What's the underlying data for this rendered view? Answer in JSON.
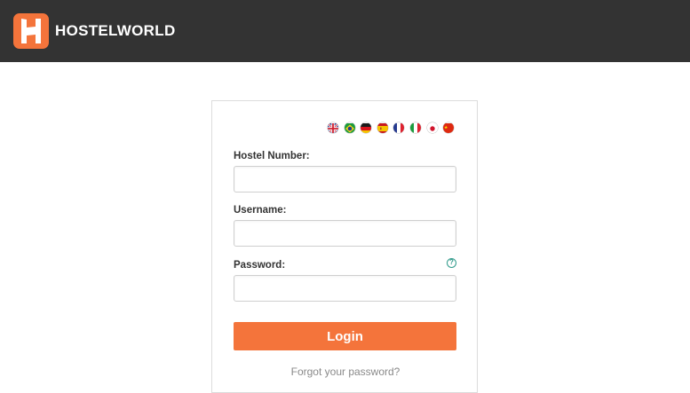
{
  "header": {
    "brand": "HOSTELWORLD",
    "logo_color": "#f4743b",
    "bar_color": "#333333"
  },
  "languages": [
    {
      "icon": "uk-flag-icon"
    },
    {
      "icon": "brazil-flag-icon"
    },
    {
      "icon": "germany-flag-icon"
    },
    {
      "icon": "spain-flag-icon"
    },
    {
      "icon": "france-flag-icon"
    },
    {
      "icon": "italy-flag-icon"
    },
    {
      "icon": "japan-flag-icon"
    },
    {
      "icon": "china-flag-icon"
    }
  ],
  "form": {
    "hostel_number_label": "Hostel Number:",
    "hostel_number_value": "",
    "username_label": "Username:",
    "username_value": "",
    "password_label": "Password:",
    "password_value": "",
    "help_icon": "?",
    "login_label": "Login",
    "forgot_link": "Forgot your password?"
  }
}
